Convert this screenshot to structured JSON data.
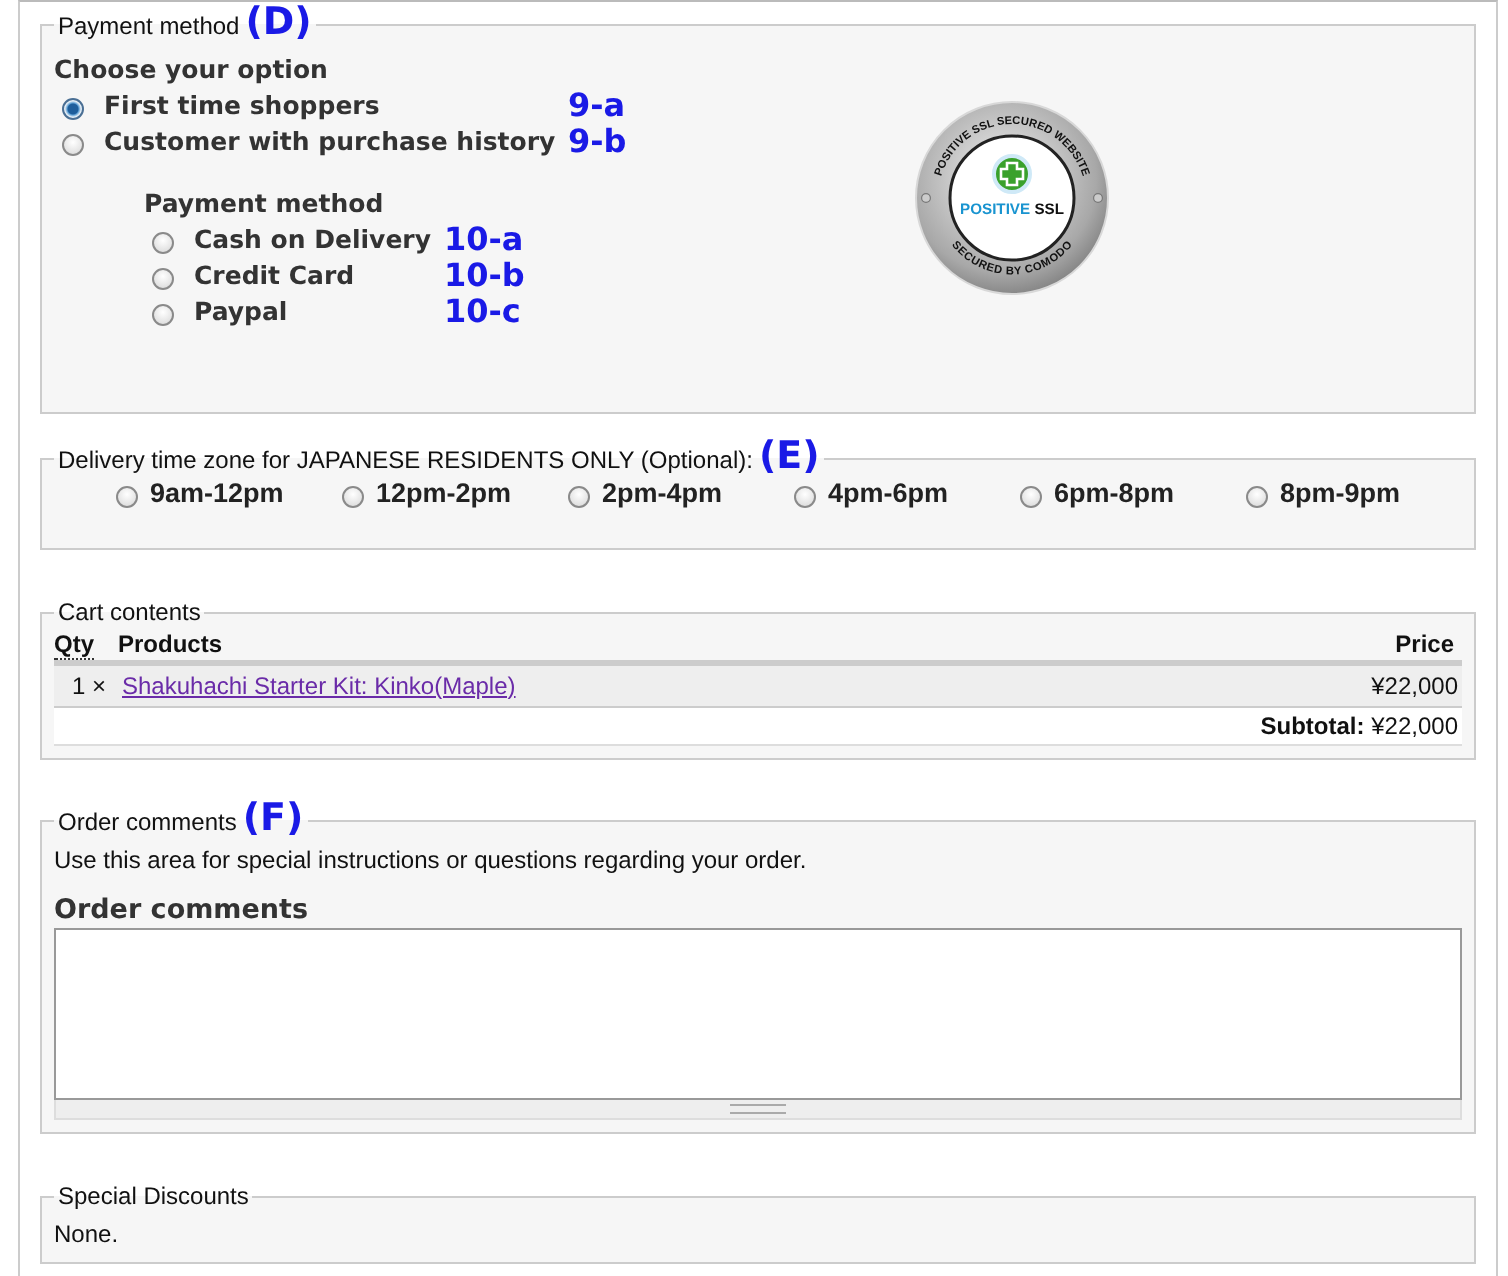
{
  "payment_method": {
    "legend": "Payment method",
    "annotation": "(D)",
    "option_heading": "Choose your option",
    "customer_options": [
      {
        "label": "First time shoppers",
        "selected": true,
        "annotation": "9-a"
      },
      {
        "label": "Customer with purchase history",
        "selected": false,
        "annotation": "9-b"
      }
    ],
    "payment_heading": "Payment method",
    "payment_options": [
      {
        "label": "Cash on Delivery",
        "selected": false,
        "annotation": "10-a"
      },
      {
        "label": "Credit Card",
        "selected": false,
        "annotation": "10-b"
      },
      {
        "label": "Paypal",
        "selected": false,
        "annotation": "10-c"
      }
    ],
    "ssl_badge": {
      "ring_top": "POSITIVE SSL SECURED WEBSITE",
      "center_left": "POSITIVE",
      "center_right": "SSL",
      "ring_bottom": "SECURED BY COMODO"
    }
  },
  "delivery": {
    "legend": "Delivery time zone for JAPANESE RESIDENTS ONLY (Optional):",
    "annotation": "(E)",
    "slots": [
      {
        "label": "9am-12pm",
        "selected": false
      },
      {
        "label": "12pm-2pm",
        "selected": false
      },
      {
        "label": "2pm-4pm",
        "selected": false
      },
      {
        "label": "4pm-6pm",
        "selected": false
      },
      {
        "label": "6pm-8pm",
        "selected": false
      },
      {
        "label": "8pm-9pm",
        "selected": false
      }
    ]
  },
  "cart": {
    "legend": "Cart contents",
    "columns": [
      "Qty",
      "Products",
      "Price"
    ],
    "rows": [
      {
        "qty": "1 ×",
        "product": "Shakuhachi Starter Kit: Kinko(Maple)",
        "price": "¥22,000"
      }
    ],
    "subtotal_label": "Subtotal:",
    "subtotal": "¥22,000"
  },
  "order_comments": {
    "legend": "Order comments",
    "annotation": "(F)",
    "hint": "Use this area for special instructions or questions regarding your order.",
    "field_label": "Order comments"
  },
  "special_discounts": {
    "legend": "Special Discounts",
    "text": "None."
  }
}
